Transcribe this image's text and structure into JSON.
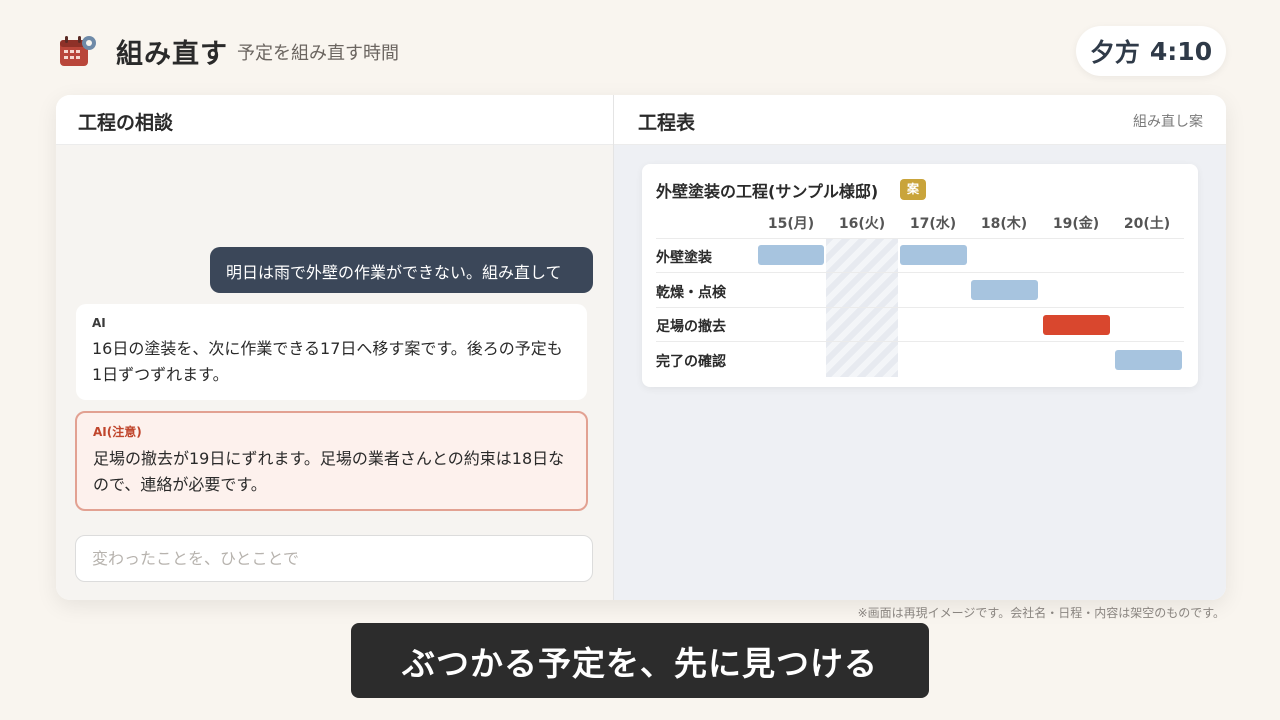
{
  "header": {
    "icon": "calendar-gear-icon",
    "title": "組み直す",
    "subtitle": "予定を組み直す時間",
    "clock_period": "夕方",
    "clock_time": "4:10"
  },
  "chat": {
    "title": "工程の相談",
    "messages": [
      {
        "role": "user",
        "text": "明日は雨で外壁の作業ができない。組み直して"
      },
      {
        "role": "ai",
        "sender": "AI",
        "text": "16日の塗装を、次に作業できる17日へ移す案です。後ろの予定も1日ずつずれます。"
      },
      {
        "role": "ai-warning",
        "sender": "AI(注意)",
        "text": "足場の撤去が19日にずれます。足場の業者さんとの約束は18日なので、連絡が必要です。"
      }
    ],
    "input_placeholder": "変わったことを、ひとことで",
    "input_value": ""
  },
  "schedule": {
    "title": "工程表",
    "tag": "組み直し案",
    "card_title": "外壁塗装の工程(サンプル様邸)",
    "badge": "案",
    "days": [
      "15(月)",
      "16(火)",
      "17(水)",
      "18(木)",
      "19(金)",
      "20(土)"
    ],
    "blocked_day": "16(火)",
    "tasks": [
      {
        "label": "外壁塗装",
        "days": [
          "15(月)",
          "17(水)"
        ],
        "status": "normal"
      },
      {
        "label": "乾燥・点検",
        "days": [
          "18(木)"
        ],
        "status": "normal"
      },
      {
        "label": "足場の撤去",
        "days": [
          "19(金)"
        ],
        "status": "conflict"
      },
      {
        "label": "完了の確認",
        "days": [
          "20(土)"
        ],
        "status": "normal"
      }
    ],
    "colors": {
      "normal": "#a7c4df",
      "conflict": "#d9472e",
      "badge": "#c9a43b"
    }
  },
  "disclaimer": "※画面は再現イメージです。会社名・日程・内容は架空のものです。",
  "caption": "ぶつかる予定を、先に見つける"
}
